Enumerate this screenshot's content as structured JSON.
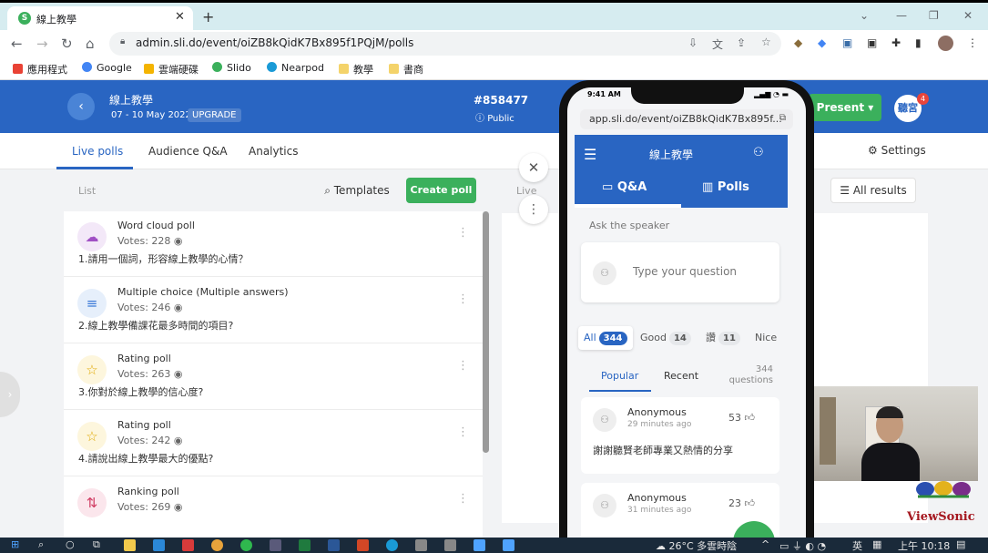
{
  "browser": {
    "tab_title": "線上教學",
    "tab_favicon": "S",
    "tab_close": "✕",
    "new_tab": "+",
    "url": "admin.sli.do/event/oiZB8kQidK7Bx895f1PQjM/polls",
    "window_minimize": "—",
    "window_restore": "❐",
    "window_close": "✕",
    "bookmarks": [
      "應用程式",
      "Google",
      "雲端硬碟",
      "Slido",
      "Nearpod",
      "教學",
      "書商"
    ]
  },
  "header": {
    "event_title": "線上教學",
    "event_date": "07 - 10 May 2022",
    "upgrade": "UPGRADE",
    "event_code": "#858477",
    "visibility": "Public",
    "present": "Present",
    "avatar": "聽宮",
    "notification_count": "4"
  },
  "tabs": [
    {
      "label": "Live polls",
      "active": true
    },
    {
      "label": "Audience Q&A",
      "active": false
    },
    {
      "label": "Analytics",
      "active": false
    }
  ],
  "settings": "Settings",
  "list_label": "List",
  "templates": "Templates",
  "create_poll": "Create poll",
  "live_label": "Live",
  "all_results": "All results",
  "polls": [
    {
      "type": "Word cloud poll",
      "votes": "Votes: 228",
      "question": "1.請用一個詞，形容線上教學的心情？",
      "icon": "cloud-icon",
      "glyph": "☁",
      "color": "#a04fc4",
      "bg": "#f3e8f8"
    },
    {
      "type": "Multiple choice (Multiple answers)",
      "votes": "Votes: 246",
      "question": "2.線上教學備課花最多時間的項目?",
      "icon": "list-icon",
      "glyph": "≡",
      "color": "#3d7bd8",
      "bg": "#e6effb"
    },
    {
      "type": "Rating poll",
      "votes": "Votes: 263",
      "question": "3.你對於線上教學的信心度?",
      "icon": "star-icon",
      "glyph": "☆",
      "color": "#e0a800",
      "bg": "#fdf6dd"
    },
    {
      "type": "Rating poll",
      "votes": "Votes: 242",
      "question": "4.請說出線上教學最大的優點?",
      "icon": "star-icon",
      "glyph": "☆",
      "color": "#e0a800",
      "bg": "#fdf6dd"
    },
    {
      "type": "Ranking poll",
      "votes": "Votes: 269",
      "question": "",
      "icon": "ranking-icon",
      "glyph": "⇅",
      "color": "#d03b62",
      "bg": "#fbe6ec"
    }
  ],
  "phone": {
    "time": "9:41 AM",
    "url": "app.sli.do/event/oiZB8kQidK7Bx895f...",
    "title": "線上教學",
    "tab_qa": "Q&A",
    "tab_polls": "Polls",
    "ask_label": "Ask the speaker",
    "input_placeholder": "Type your question",
    "filters": [
      {
        "label": "All",
        "count": "344"
      },
      {
        "label": "Good",
        "count": "14"
      },
      {
        "label": "讚",
        "count": "11"
      },
      {
        "label": "Nice",
        "count": ""
      }
    ],
    "sort_popular": "Popular",
    "sort_recent": "Recent",
    "question_count": "344",
    "question_count_label": "questions",
    "questions": [
      {
        "author": "Anonymous",
        "time": "29 minutes ago",
        "likes": "53",
        "text": "謝謝聽賢老師專業又熱情的分享"
      },
      {
        "author": "Anonymous",
        "time": "31 minutes ago",
        "likes": "23",
        "text": ""
      }
    ]
  },
  "overlay_brand": "ViewSonic",
  "taskbar": {
    "weather": "26°C 多雲時陰",
    "ime": "英",
    "clock": "上午 10:18"
  },
  "colors": {
    "brand_blue": "#2965c2",
    "green": "#3bb05c",
    "badge_red": "#e8453c"
  }
}
